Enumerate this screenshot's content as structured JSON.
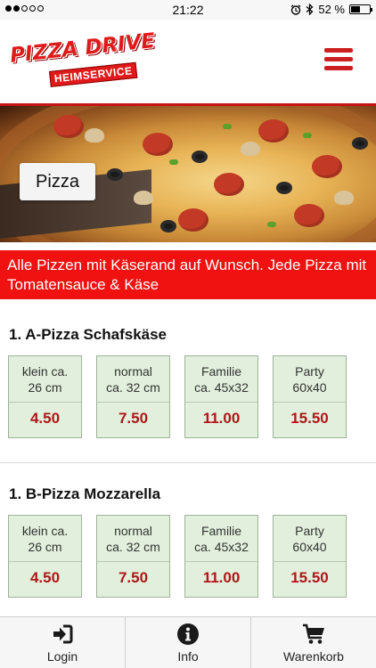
{
  "status_bar": {
    "time": "21:22",
    "battery_text": "52 %",
    "battery_level": 0.52
  },
  "header": {
    "logo_line1": "PIZZA DRIVE",
    "logo_line2": "HEIMSERVICE"
  },
  "hero": {
    "category_label": "Pizza"
  },
  "banner": {
    "text": "Alle Pizzen mit Käserand auf Wunsch. Jede Pizza mit Tomatensauce & Käse"
  },
  "products": [
    {
      "title": "1. A-Pizza Schafskäse",
      "sizes": [
        {
          "label": "klein ca.\n26 cm",
          "price": "4.50"
        },
        {
          "label": "normal\nca. 32 cm",
          "price": "7.50"
        },
        {
          "label": "Familie\nca. 45x32",
          "price": "11.00"
        },
        {
          "label": "Party\n60x40",
          "price": "15.50"
        }
      ]
    },
    {
      "title": "1. B-Pizza Mozzarella",
      "sizes": [
        {
          "label": "klein ca.\n26 cm",
          "price": "4.50"
        },
        {
          "label": "normal\nca. 32 cm",
          "price": "7.50"
        },
        {
          "label": "Familie\nca. 45x32",
          "price": "11.00"
        },
        {
          "label": "Party\n60x40",
          "price": "15.50"
        }
      ]
    }
  ],
  "tabbar": {
    "login": "Login",
    "info": "Info",
    "cart": "Warenkorb"
  },
  "colors": {
    "accent_red": "#f01111",
    "price_red": "#b0161a",
    "size_box_bg": "#e2efdc"
  },
  "icons": [
    "signal-dots-icon",
    "alarm-icon",
    "bluetooth-icon",
    "battery-icon",
    "hamburger-menu-icon",
    "login-icon",
    "info-icon",
    "cart-icon"
  ]
}
